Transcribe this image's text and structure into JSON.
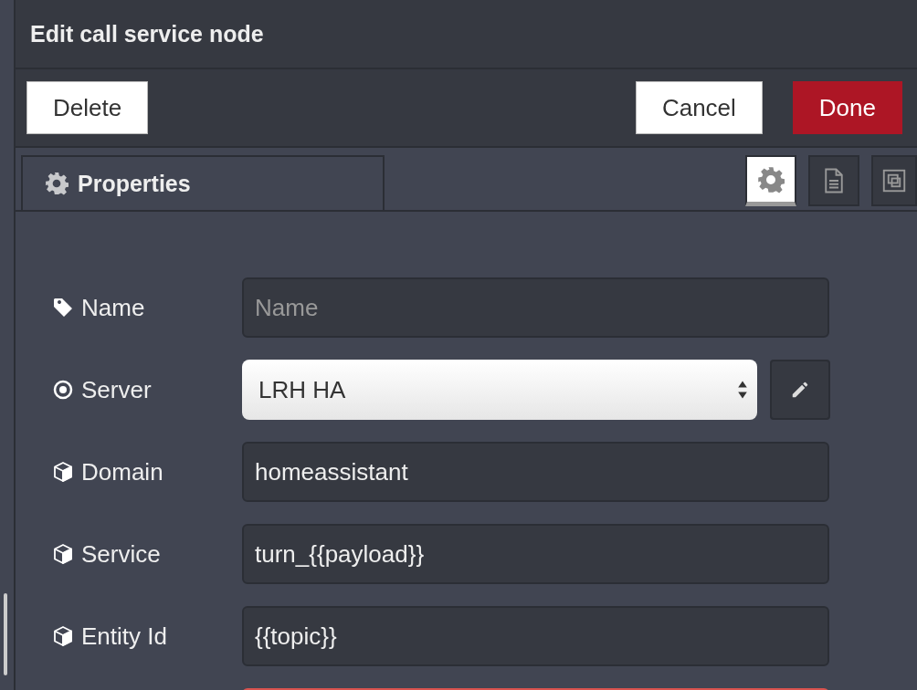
{
  "dialog": {
    "title": "Edit call service node"
  },
  "buttons": [
    {
      "label": "Delete",
      "kind": "plain"
    },
    {
      "label": "Cancel",
      "kind": "plain"
    },
    {
      "label": "Done",
      "kind": "primary"
    }
  ],
  "tab": {
    "label": "Properties"
  },
  "view_tabs": [
    {
      "selected": true
    },
    {
      "selected": false
    },
    {
      "selected": false
    }
  ],
  "fields": [
    {
      "kind": "text",
      "label": "Name",
      "placeholder": "Name"
    },
    {
      "kind": "select",
      "label": "Server",
      "value": "LRH HA"
    },
    {
      "kind": "property",
      "label": "Domain",
      "value": "homeassistant"
    },
    {
      "kind": "property",
      "label": "Service",
      "value": "turn_{{payload}}"
    },
    {
      "kind": "property",
      "label": "Entity Id",
      "value": "{{topic}}"
    },
    {
      "kind": "error"
    }
  ]
}
